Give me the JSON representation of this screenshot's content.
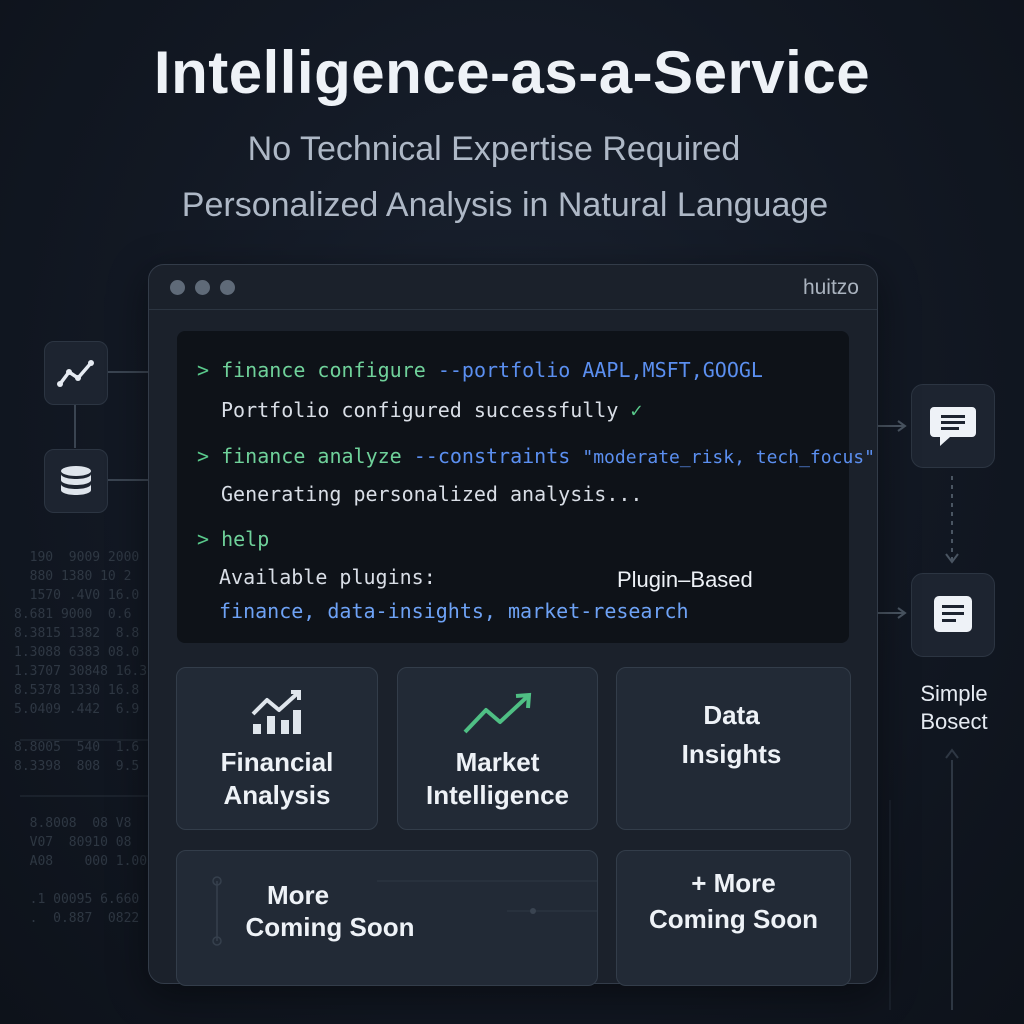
{
  "hero": {
    "title": "Intelligence-as-a-Service",
    "subtitle_1": "No Technical Expertise Required",
    "subtitle_2": "Personalized Analysis in Natural Language"
  },
  "window": {
    "title": "huitzo"
  },
  "terminal": {
    "prompt_symbol": ">",
    "line1": {
      "command": "finance configure",
      "flag": "--portfolio",
      "value": "AAPL,MSFT,GOOGL"
    },
    "line2": {
      "output": "Portfolio configured successfully",
      "check": "✓"
    },
    "line3": {
      "command": "finance analyze",
      "flag": "--constraints",
      "value": "\"moderate_risk, tech_focus\""
    },
    "line4": {
      "output": "Generating personalized analysis..."
    },
    "line5": {
      "command": "help"
    },
    "line6": {
      "output": "Available plugins:"
    },
    "line7": {
      "output": "finance, data-insights, market-research"
    },
    "badge": "Plugin–Based"
  },
  "cards": [
    {
      "line1": "Financial",
      "line2": "Analysis",
      "icon": "bar-chart-trend-icon"
    },
    {
      "line1": "Market",
      "line2": "Intelligence",
      "icon": "trend-up-icon"
    },
    {
      "line1": "Data",
      "line2": "Insights",
      "icon": "none"
    },
    {
      "line1": "More",
      "line2": "Coming Soon",
      "icon": "circuit-icon"
    },
    {
      "line1": "+ More",
      "line2": "Coming Soon",
      "icon": "none"
    }
  ],
  "right_side": {
    "label_line1": "Simple",
    "label_line2": "Bosect"
  },
  "icons": {
    "left_top": "line-chart-icon",
    "left_bottom": "database-icon",
    "right_top": "chat-bubble-icon",
    "right_bottom": "document-icon"
  },
  "colors": {
    "accent_green": "#59c98b",
    "accent_blue": "#5b8ff0",
    "background": "#121823"
  },
  "background_numbers": "  190  9009 2000\n  880 1380 10 2\n  1570 .4V0 16.0\n8.681 9000  0.6\n8.3815 1382  8.8\n1.3088 6383 08.0\n1.3707 30848 16.3\n8.5378 1330 16.8\n5.0409 .442  6.9\n\n8.8005  540  1.6\n8.3398  808  9.5\n\n\n  8.8008  08 V8\n  V07  80910 08\n  A08    000 1.00\n\n  .1 00095 6.660\n  .  0.887  0822"
}
